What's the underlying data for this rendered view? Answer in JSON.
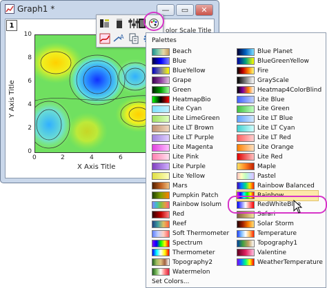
{
  "window": {
    "title": "Graph1 *",
    "layer_label": "1",
    "min": "—",
    "max": "▭",
    "close": "✕"
  },
  "plot": {
    "x_title": "X Axis Title",
    "y_title": "Y Axis Title",
    "color_scale_title": "olor Scale Title",
    "y_ticks": [
      "10",
      "8",
      "6",
      "4",
      "2",
      "0"
    ],
    "x_ticks": [
      "0",
      "2",
      "4",
      "6",
      "8"
    ]
  },
  "menu": {
    "header": "Palettes",
    "set_colors": "Set Colors...",
    "left": [
      {
        "label": "Beach",
        "g": "linear-gradient(90deg,#1b8f8f,#7ac8a8,#e8d9a8,#c49a5a)"
      },
      {
        "label": "Blue",
        "g": "linear-gradient(90deg,#000040,#0000ff,#8080ff)"
      },
      {
        "label": "BlueYellow",
        "g": "linear-gradient(90deg,#0000c0,#8080a0,#ffff00)"
      },
      {
        "label": "Grape",
        "g": "linear-gradient(90deg,#3a0050,#9040a0,#e0c0e0)"
      },
      {
        "label": "Green",
        "g": "linear-gradient(90deg,#002000,#00a000,#a0ffa0)"
      },
      {
        "label": "HeatmapBio",
        "g": "linear-gradient(90deg,#00ff00,#000000,#ff0000)"
      },
      {
        "label": "Lite Cyan",
        "g": "linear-gradient(90deg,#80e0ff,#c0f0ff)"
      },
      {
        "label": "Lite LimeGreen",
        "g": "linear-gradient(90deg,#a0e060,#e0ffc0)"
      },
      {
        "label": "Lite LT Brown",
        "g": "linear-gradient(90deg,#c09070,#f0d8c0)"
      },
      {
        "label": "Lite LT Purple",
        "g": "linear-gradient(90deg,#a080e0,#e0d0ff)"
      },
      {
        "label": "Lite Magenta",
        "g": "linear-gradient(90deg,#e040e0,#ffc0ff)"
      },
      {
        "label": "Lite Pink",
        "g": "linear-gradient(90deg,#ff80b0,#ffe0f0)"
      },
      {
        "label": "Lite Purple",
        "g": "linear-gradient(90deg,#8040c0,#d0b0ff)"
      },
      {
        "label": "Lite Yellow",
        "g": "linear-gradient(90deg,#e0e040,#ffffc0)"
      },
      {
        "label": "Mars",
        "g": "linear-gradient(90deg,#502000,#c06020,#f0c080)"
      },
      {
        "label": "Pumpkin Patch",
        "g": "linear-gradient(90deg,#204000,#80a000,#ff8000)"
      },
      {
        "label": "Rainbow Isolum",
        "g": "linear-gradient(90deg,#8080ff,#40c0c0,#80c040,#e0a040,#ff6080)"
      },
      {
        "label": "Red",
        "g": "linear-gradient(90deg,#300000,#c00000,#ff8080)"
      },
      {
        "label": "Reef",
        "g": "linear-gradient(90deg,#204080,#40a0a0,#e0c060,#ff6040)"
      },
      {
        "label": "Soft Thermometer",
        "g": "linear-gradient(90deg,#6080ff,#c0d0ff,#ffd0c0,#ff6060)"
      },
      {
        "label": "Spectrum",
        "g": "linear-gradient(90deg,#8000ff,#0000ff,#00ff00,#ffff00,#ff0000)"
      },
      {
        "label": "Thermometer",
        "g": "linear-gradient(90deg,#0000ff,#00ffff,#ffffff,#ffff00,#ff0000)"
      },
      {
        "label": "Topography2",
        "g": "linear-gradient(90deg,#206020,#a0c060,#e0c080,#a06040,#ffffff)"
      },
      {
        "label": "Watermelon",
        "g": "linear-gradient(90deg,#206020,#80c060,#ffffff,#ff8080,#e02040)"
      }
    ],
    "right": [
      {
        "label": "Blue Planet",
        "g": "linear-gradient(90deg,#000030,#0060c0,#80e0ff)"
      },
      {
        "label": "BlueGreenYellow",
        "g": "linear-gradient(90deg,#0000a0,#00a080,#ffff00)"
      },
      {
        "label": "Fire",
        "g": "linear-gradient(90deg,#000000,#c00000,#ff8000,#ffff80)"
      },
      {
        "label": "GrayScale",
        "g": "linear-gradient(90deg,#000000,#ffffff)"
      },
      {
        "label": "Heatmap4ColorBlind",
        "g": "linear-gradient(90deg,#000000,#8000a0,#ff8000,#ffffff)"
      },
      {
        "label": "Lite Blue",
        "g": "linear-gradient(90deg,#4060ff,#c0d0ff)"
      },
      {
        "label": "Lite Green",
        "g": "linear-gradient(90deg,#40c040,#c0ffc0)"
      },
      {
        "label": "Lite LT Blue",
        "g": "linear-gradient(90deg,#60a0ff,#d0e8ff)"
      },
      {
        "label": "Lite LT Cyan",
        "g": "linear-gradient(90deg,#40d0d0,#d0ffff)"
      },
      {
        "label": "Lite LT Red",
        "g": "linear-gradient(90deg,#ff6060,#ffd0d0)"
      },
      {
        "label": "Lite Orange",
        "g": "linear-gradient(90deg,#ff8000,#ffe0c0)"
      },
      {
        "label": "Lite Red",
        "g": "linear-gradient(90deg,#e00000,#ffc0c0)"
      },
      {
        "label": "Maple",
        "g": "linear-gradient(90deg,#ffe060,#ff8020,#c02000)"
      },
      {
        "label": "Pastel",
        "g": "linear-gradient(90deg,#ffc0c0,#ffffc0,#c0ffc0,#c0e0ff,#e0c0ff)"
      },
      {
        "label": "Rainbow Balanced",
        "g": "linear-gradient(90deg,#4000c0,#0080ff,#00e080,#ffe000,#ff2000)"
      },
      {
        "label": "Rainbow",
        "g": "linear-gradient(90deg,#ff00ff,#0000ff,#00ffff,#00ff00,#ffff00,#ff0000)"
      },
      {
        "label": "RedWhiteBlue",
        "g": "linear-gradient(90deg,#0000ff,#ffffff,#ff0000)"
      },
      {
        "label": "Safari",
        "g": "linear-gradient(90deg,#806040,#c0a060,#f0e0a0)"
      },
      {
        "label": "Solar Storm",
        "g": "linear-gradient(90deg,#200000,#a02000,#ff8000,#ffe080)"
      },
      {
        "label": "Temperature",
        "g": "linear-gradient(90deg,#2040ff,#80c0ff,#ffffff,#ffc060,#ff2000)"
      },
      {
        "label": "Topography1",
        "g": "linear-gradient(90deg,#0040a0,#40a040,#c0a060,#ffffff)"
      },
      {
        "label": "Valentine",
        "g": "linear-gradient(90deg,#600020,#e02060,#ffc0e0)"
      },
      {
        "label": "WeatherTemperature",
        "g": "linear-gradient(90deg,#8000ff,#0080ff,#00ff80,#ffff00,#ff0000)"
      }
    ]
  }
}
